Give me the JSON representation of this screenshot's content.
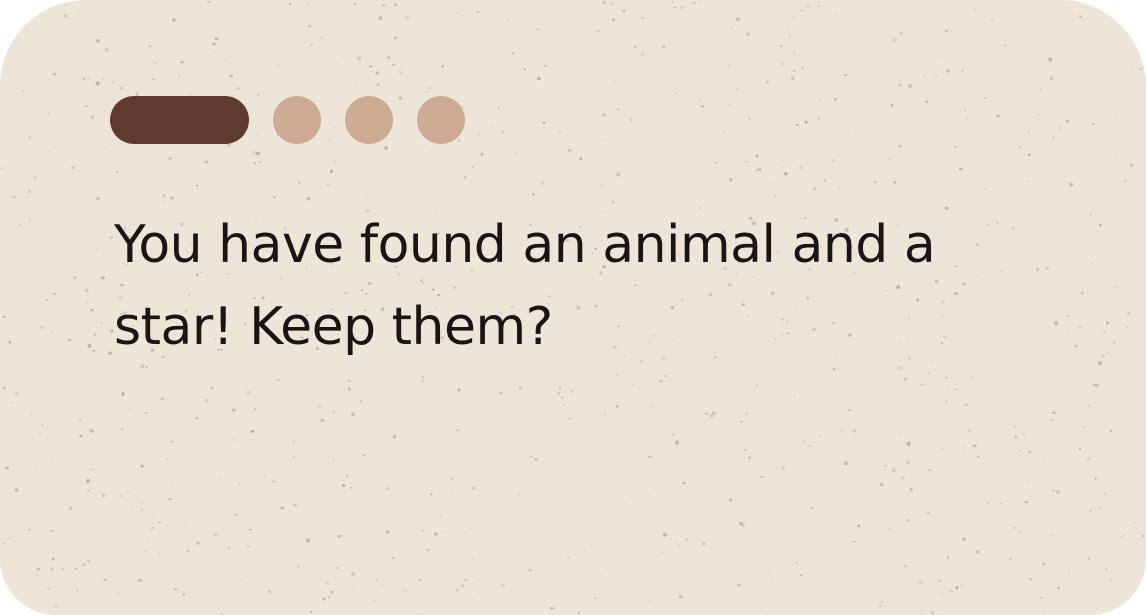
{
  "dialog": {
    "message": "You have found an animal and a star! Keep them?",
    "progress": {
      "total_steps": 4,
      "current_step": 1
    }
  },
  "colors": {
    "card_background": "#ede5d8",
    "active_step": "#5e3a30",
    "inactive_step": "#cdab93",
    "text": "#1a1512",
    "speckle": "#b1aa9f"
  }
}
